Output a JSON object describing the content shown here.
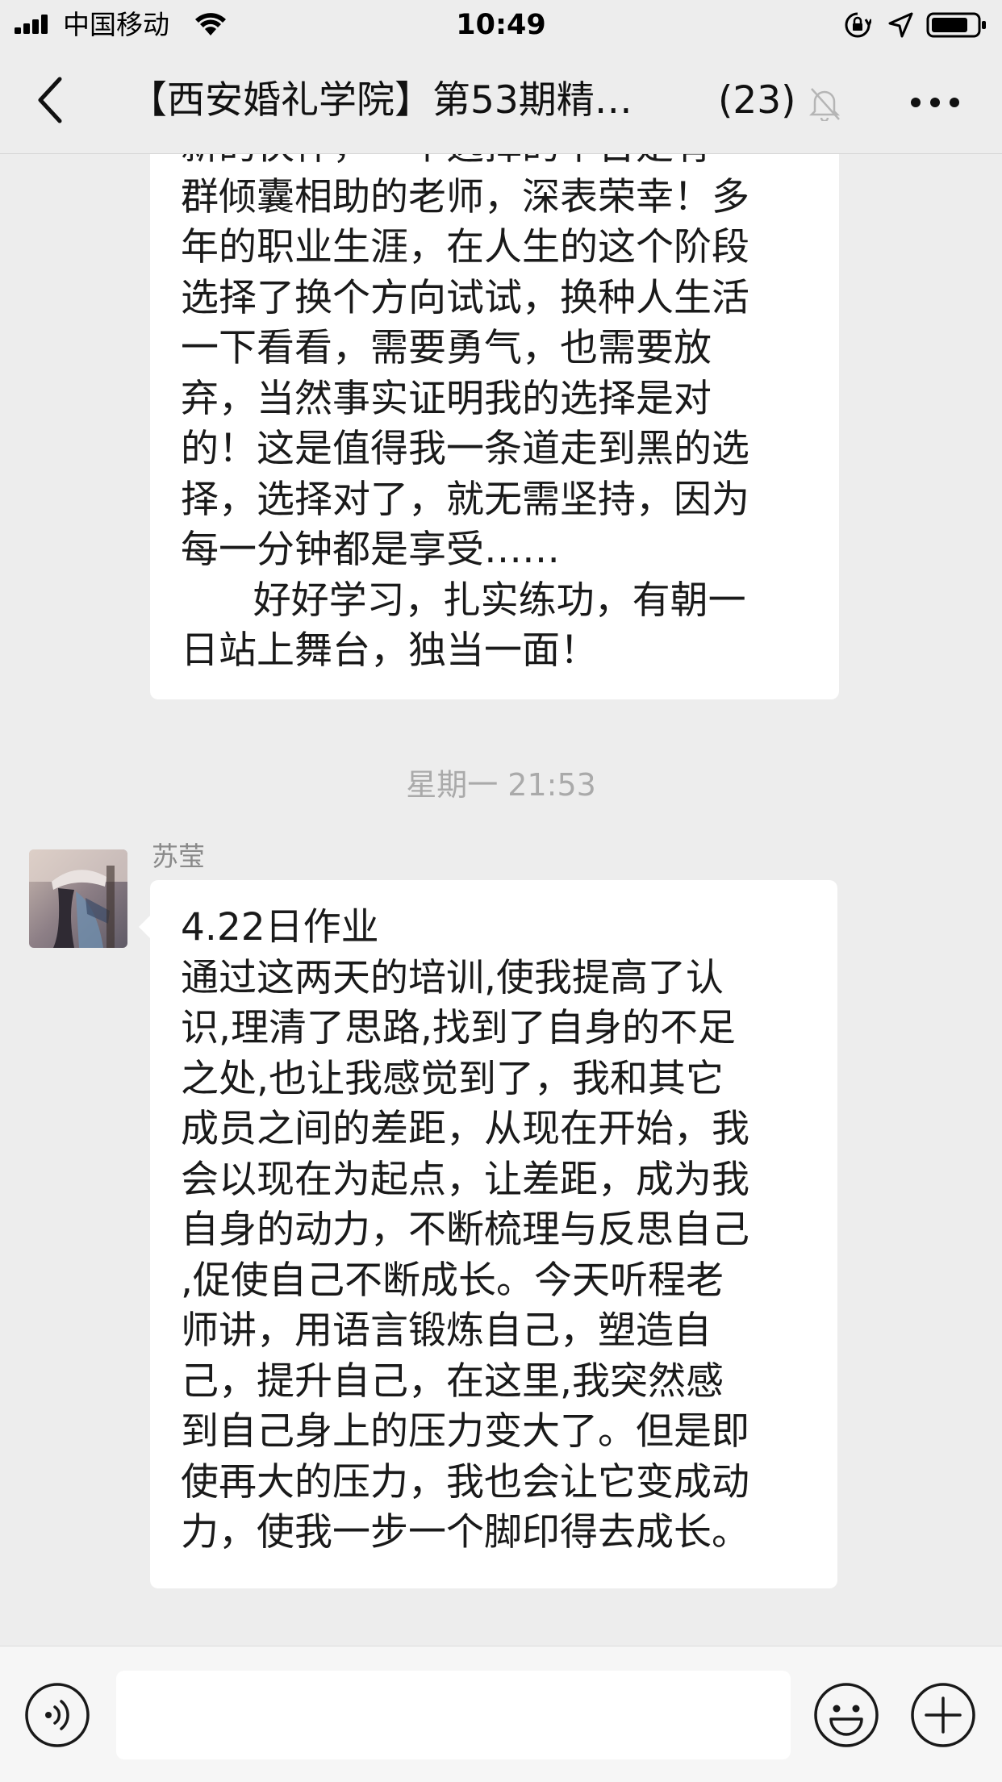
{
  "status_bar": {
    "carrier": "中国移动",
    "time": "10:49"
  },
  "nav": {
    "title": "【西安婚礼学院】第53期精…",
    "member_count": "(23)"
  },
  "messages": {
    "first_text": "新的伙伴，一个选择的平台是有\n群倾囊相助的老师，深表荣幸！多\n年的职业生涯，在人生的这个阶段\n选择了换个方向试试，换种人生活\n一下看看，需要勇气，也需要放\n弃，当然事实证明我的选择是对\n的！这是值得我一条道走到黑的选\n择，选择对了，就无需坚持，因为\n每一分钟都是享受……\n      好好学习，扎实练功，有朝一\n日站上舞台，独当一面！",
    "time_divider": "星期一 21:53",
    "sender_name": "苏莹",
    "second_text": "4.22日作业\n通过这两天的培训,使我提高了认\n识,理清了思路,找到了自身的不足\n之处,也让我感觉到了，我和其它\n成员之间的差距，从现在开始，我\n会以现在为起点，让差距，成为我\n自身的动力，不断梳理与反思自己\n,促使自己不断成长。今天听程老\n师讲，用语言锻炼自己，塑造自\n己，提升自己，在这里,我突然感\n到自己身上的压力变大了。但是即\n使再大的压力，我也会让它变成动\n力，使我一步一个脚印得去成长。"
  },
  "input": {
    "value": "",
    "placeholder": ""
  },
  "icons": {
    "back": "chevron-left-icon",
    "mute": "bell-slash-icon",
    "more": "more-dots-icon",
    "voice": "voice-icon",
    "emoji": "emoji-icon",
    "plus": "plus-icon"
  },
  "colors": {
    "background": "#ededed",
    "bubble": "#ffffff",
    "muted_text": "#aaaaaa"
  }
}
